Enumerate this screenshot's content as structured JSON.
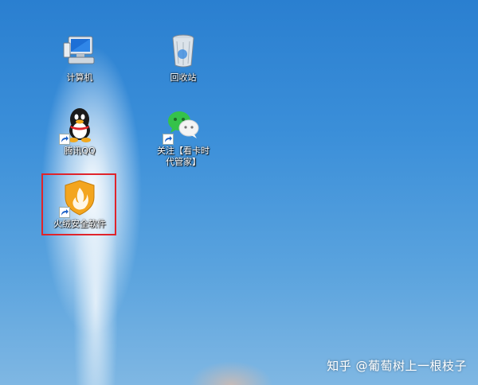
{
  "desktop": {
    "icons": [
      {
        "label": "计算机",
        "icon": "computer-icon"
      },
      {
        "label": "回收站",
        "icon": "recycle-bin-icon"
      },
      {
        "label": "腾讯QQ",
        "icon": "qq-penguin-icon"
      },
      {
        "label": "关注【看卡时\n代管家】",
        "icon": "wechat-icon"
      },
      {
        "label": "火绒安全软件",
        "icon": "huorong-shield-icon"
      }
    ]
  },
  "watermark": {
    "text": "知乎 @葡萄树上一根枝子"
  },
  "colors": {
    "selection_border": "#e0242b",
    "desktop_blue": "#3b8fd9"
  }
}
